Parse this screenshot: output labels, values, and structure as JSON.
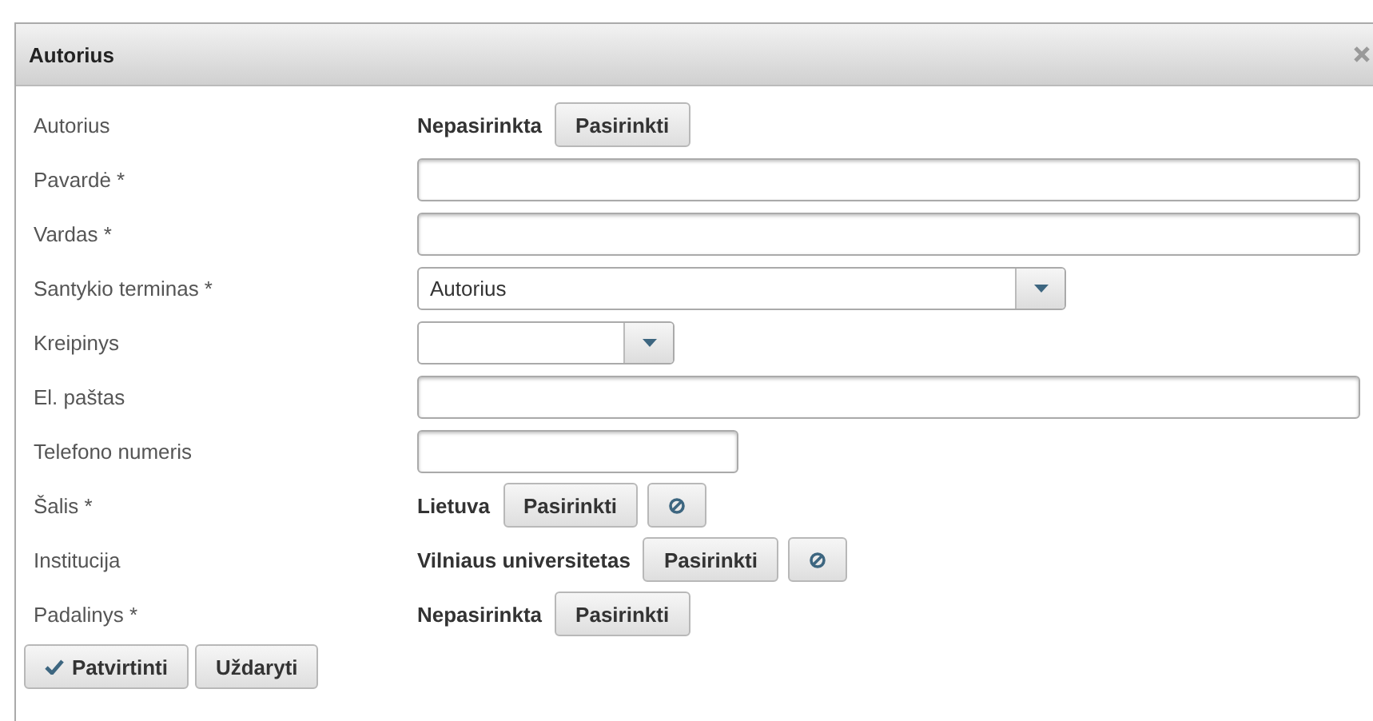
{
  "dialog": {
    "title": "Autorius",
    "fields": [
      {
        "label": "Autorius",
        "kind": "choice",
        "value": "Nepasirinkta",
        "button": "Pasirinkti",
        "clearable": false
      },
      {
        "label": "Pavardė *",
        "kind": "text"
      },
      {
        "label": "Vardas *",
        "kind": "text"
      },
      {
        "label": "Santykio terminas *",
        "kind": "select",
        "value": "Autorius"
      },
      {
        "label": "Kreipinys",
        "kind": "select"
      },
      {
        "label": "El. paštas",
        "kind": "text"
      },
      {
        "label": "Telefono numeris",
        "kind": "text"
      },
      {
        "label": "Šalis *",
        "kind": "choice",
        "value": "Lietuva",
        "button": "Pasirinkti",
        "clearable": true
      },
      {
        "label": "Institucija",
        "kind": "choice",
        "value": "Vilniaus universitetas",
        "button": "Pasirinkti",
        "clearable": true
      },
      {
        "label": "Padalinys *",
        "kind": "choice",
        "value": "Nepasirinkta",
        "button": "Pasirinkti",
        "clearable": false
      }
    ],
    "buttons": [
      {
        "label": "Patvirtinti",
        "kind": "confirm"
      },
      {
        "label": "Uždaryti",
        "kind": "plain"
      }
    ]
  }
}
